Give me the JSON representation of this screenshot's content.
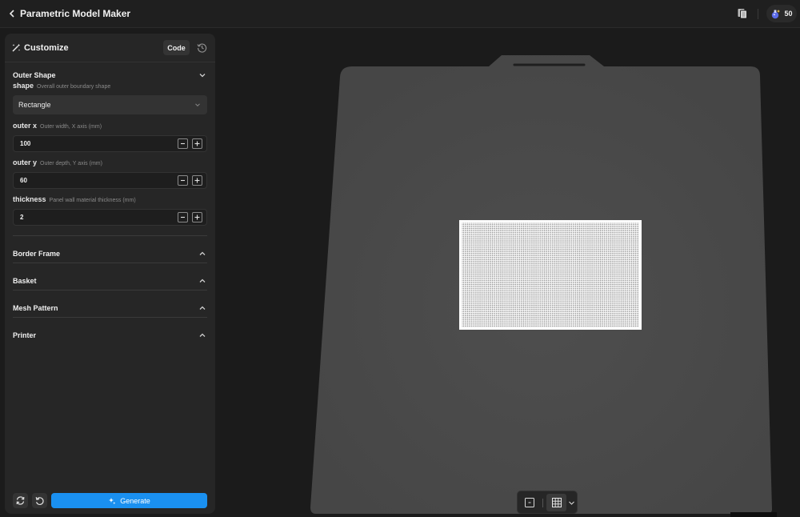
{
  "header": {
    "title": "Parametric Model Maker",
    "credits": "50"
  },
  "panel": {
    "title": "Customize",
    "code_label": "Code",
    "sections": {
      "outer_shape": "Outer Shape",
      "border_frame": "Border Frame",
      "basket": "Basket",
      "mesh_pattern": "Mesh Pattern",
      "printer": "Printer"
    },
    "fields": {
      "shape": {
        "label": "shape",
        "hint": "Overall outer boundary shape",
        "value": "Rectangle"
      },
      "outer_x": {
        "label": "outer x",
        "hint": "Outer width, X axis (mm)",
        "value": "100"
      },
      "outer_y": {
        "label": "outer y",
        "hint": "Outer depth, Y axis (mm)",
        "value": "60"
      },
      "thickness": {
        "label": "thickness",
        "hint": "Panel wall material thickness (mm)",
        "value": "2"
      }
    },
    "generate_label": "Generate"
  },
  "colors": {
    "accent": "#1a90f0",
    "plate": "#4a4a4a",
    "model": "#f6f6f6"
  },
  "icons": {
    "back": "chevron-left-icon",
    "copy": "copy-icon",
    "credits": "potion-icon",
    "customize": "wand-icon",
    "history": "history-icon",
    "regenerate": "refresh-icon",
    "undo": "undo-icon",
    "generate": "sparkle-icon",
    "view_single": "square-icon",
    "view_grid": "grid-icon"
  }
}
